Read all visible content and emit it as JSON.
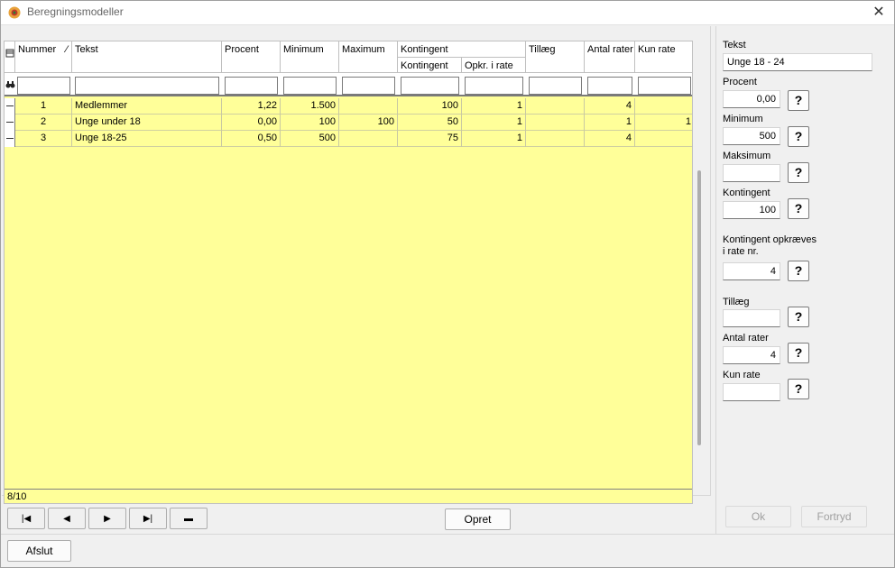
{
  "window": {
    "title": "Beregningsmodeller",
    "close_glyph": "✕",
    "icon": "app-gear-icon"
  },
  "grid": {
    "columns": [
      {
        "key": "nummer",
        "label": "Nummer"
      },
      {
        "key": "tekst",
        "label": "Tekst"
      },
      {
        "key": "procent",
        "label": "Procent"
      },
      {
        "key": "minimum",
        "label": "Minimum"
      },
      {
        "key": "maximum",
        "label": "Maximum"
      },
      {
        "key": "kontingent_group",
        "label": "Kontingent"
      },
      {
        "key": "kontingent",
        "label": "Kontingent"
      },
      {
        "key": "opkr",
        "label": "Opkr. i rate"
      },
      {
        "key": "tillaeg",
        "label": "Tillæg"
      },
      {
        "key": "antal_rater",
        "label": "Antal rater"
      },
      {
        "key": "kun_rate",
        "label": "Kun rate"
      }
    ],
    "sort_glyph": "⁄",
    "rows": [
      {
        "nummer": "1",
        "tekst": "Medlemmer",
        "procent": "1,22",
        "minimum": "1.500",
        "maximum": "",
        "kontingent": "100",
        "opkr": "1",
        "tillaeg": "",
        "antal_rater": "4",
        "kun_rate": ""
      },
      {
        "nummer": "2",
        "tekst": "Unge under 18",
        "procent": "0,00",
        "minimum": "100",
        "maximum": "100",
        "kontingent": "50",
        "opkr": "1",
        "tillaeg": "",
        "antal_rater": "1",
        "kun_rate": "1"
      },
      {
        "nummer": "3",
        "tekst": "Unge 18-25",
        "procent": "0,50",
        "minimum": "500",
        "maximum": "",
        "kontingent": "75",
        "opkr": "1",
        "tillaeg": "",
        "antal_rater": "4",
        "kun_rate": ""
      }
    ],
    "status": "8/10"
  },
  "nav": {
    "first": "|◀",
    "prev": "◀",
    "next": "▶",
    "last": "▶|",
    "delete": "▬"
  },
  "buttons": {
    "create": "Opret",
    "exit": "Afslut",
    "ok": "Ok",
    "cancel": "Fortryd"
  },
  "form": {
    "tekst": {
      "label": "Tekst",
      "value": "Unge 18 - 24"
    },
    "procent": {
      "label": "Procent",
      "value": "0,00"
    },
    "minimum": {
      "label": "Minimum",
      "value": "500"
    },
    "maksimum": {
      "label": "Maksimum",
      "value": ""
    },
    "kontingent": {
      "label": "Kontingent",
      "value": "100"
    },
    "kontingent_rate": {
      "label_line1": "Kontingent opkræves",
      "label_line2": "i rate nr.",
      "value": "4"
    },
    "tillaeg": {
      "label": "Tillæg",
      "value": ""
    },
    "antal_rater": {
      "label": "Antal rater",
      "value": "4"
    },
    "kun_rate": {
      "label": "Kun rate",
      "value": ""
    },
    "help_glyph": "?"
  }
}
